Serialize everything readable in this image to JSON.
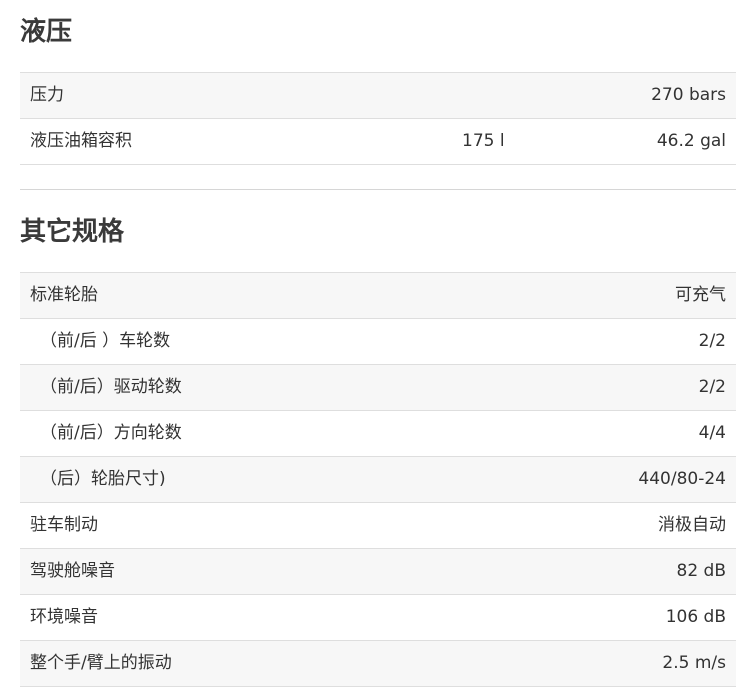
{
  "hydraulics": {
    "title": "液压",
    "rows": [
      {
        "label": "压力",
        "metric": "",
        "value": "270 bars"
      },
      {
        "label": "液压油箱容积",
        "metric": "175 l",
        "value": "46.2 gal"
      }
    ]
  },
  "other_specs": {
    "title": "其它规格",
    "rows": [
      {
        "label": "标准轮胎",
        "value": "可充气"
      },
      {
        "label": "（前/后 ）车轮数",
        "value": "2/2"
      },
      {
        "label": "（前/后）驱动轮数",
        "value": "2/2"
      },
      {
        "label": "（前/后）方向轮数",
        "value": "4/4"
      },
      {
        "label": "（后）轮胎尺寸)",
        "value": "440/80-24"
      },
      {
        "label": "驻车制动",
        "value": "消极自动"
      },
      {
        "label": "驾驶舱噪音",
        "value": "82 dB"
      },
      {
        "label": "环境噪音",
        "value": "106 dB"
      },
      {
        "label": "整个手/臂上的振动",
        "value": "2.5 m/s"
      }
    ]
  }
}
